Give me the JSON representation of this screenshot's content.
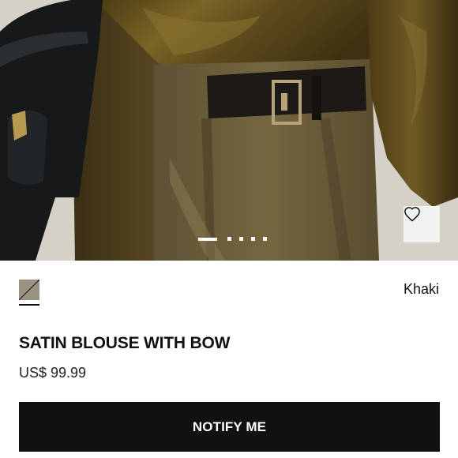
{
  "gallery": {
    "image_alt": "Satin blouse worn with khaki pleated trousers and black leather belt",
    "slide_count": 5,
    "active_slide": 1
  },
  "wishlist": {
    "icon": "heart-outline-icon"
  },
  "product": {
    "color_name": "Khaki",
    "swatch_color": "#9b9381",
    "title": "SATIN BLOUSE WITH BOW",
    "price": "US$ 99.99"
  },
  "actions": {
    "notify_label": "NOTIFY ME"
  },
  "colors": {
    "accent": "#111111",
    "background": "#ffffff"
  }
}
